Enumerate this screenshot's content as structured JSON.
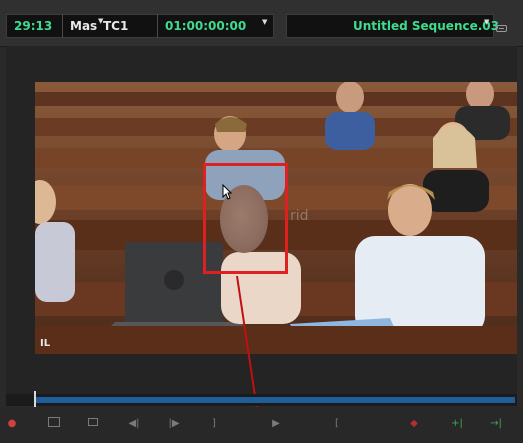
{
  "header": {
    "source_timecode": "29:13",
    "source_name": "Mas",
    "timecode_format": "TC1",
    "record_timecode": "01:00:00:00",
    "sequence_name": "Untitled Sequence.03"
  },
  "viewer": {
    "watermark_corner": "IL"
  },
  "colors": {
    "timecode_green": "#3fdc8f",
    "highlight_red": "#e02020",
    "timeline_blue": "#1f5e98"
  },
  "transport": {
    "buttons": [
      {
        "icon": "record-icon"
      },
      {
        "icon": "clip-view-icon"
      },
      {
        "icon": "filmstrip-icon"
      },
      {
        "icon": "step-back-icon",
        "glyph": "◀|"
      },
      {
        "icon": "step-forward-icon",
        "glyph": "|▶"
      },
      {
        "icon": "mark-out-icon",
        "glyph": "]"
      },
      {
        "icon": "play-icon",
        "glyph": "▶"
      },
      {
        "icon": "mark-in-icon",
        "glyph": "["
      },
      {
        "icon": "marker-icon",
        "glyph": "◆"
      },
      {
        "icon": "splice-in-icon",
        "glyph": "+|"
      },
      {
        "icon": "overwrite-icon",
        "glyph": "→|"
      }
    ]
  }
}
